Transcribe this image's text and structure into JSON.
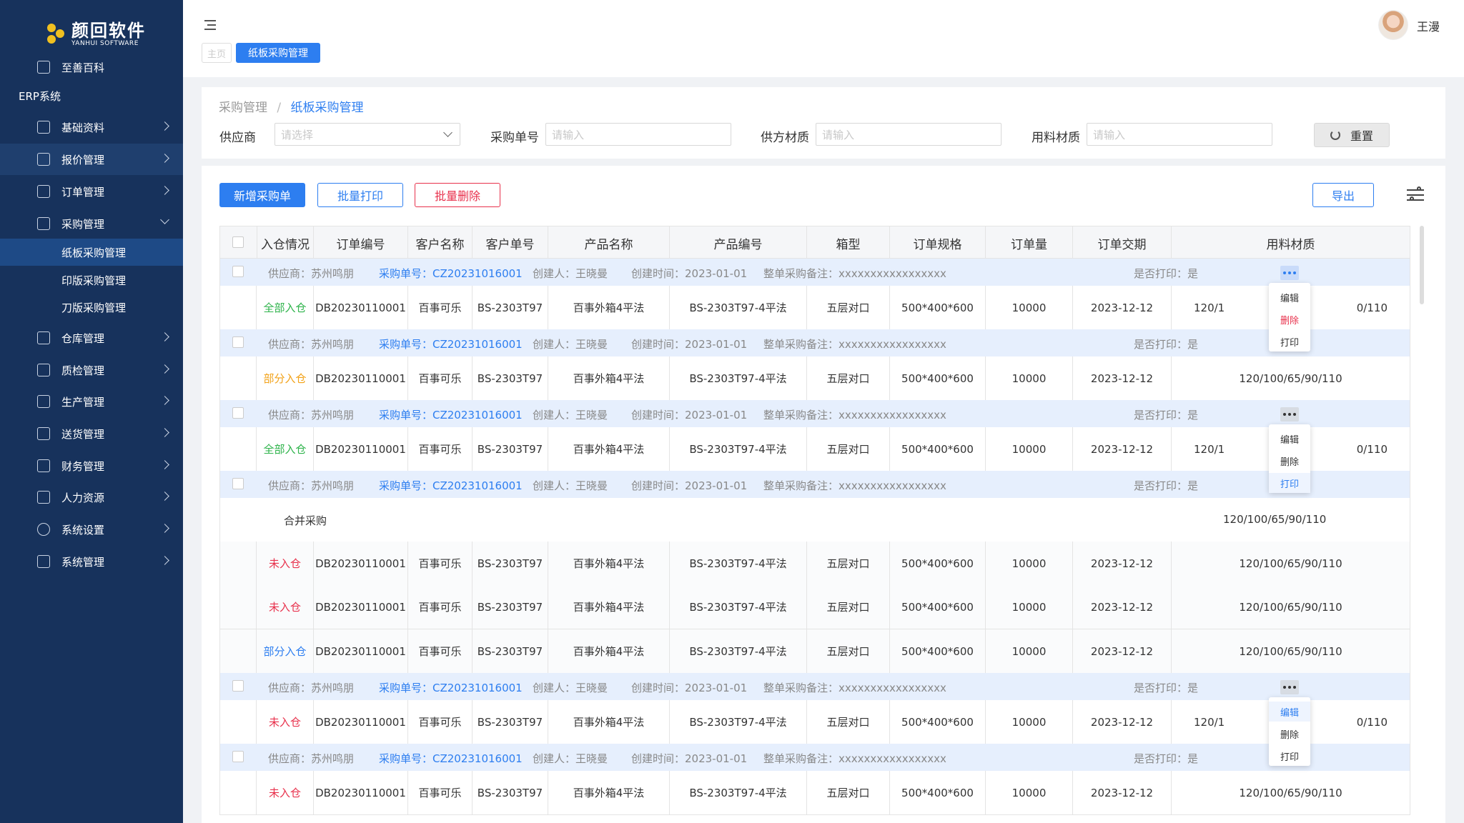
{
  "logo": {
    "cn": "颜回软件",
    "en": "YANHUI SOFTWARE"
  },
  "sidebar": {
    "top_item": {
      "label": "至善百科",
      "icon": "book-icon"
    },
    "section": "ERP系统",
    "items": [
      {
        "label": "基础资料",
        "icon": "profile-icon"
      },
      {
        "label": "报价管理",
        "icon": "quote-icon"
      },
      {
        "label": "订单管理",
        "icon": "order-icon"
      },
      {
        "label": "采购管理",
        "icon": "purchase-icon"
      },
      {
        "label": "仓库管理",
        "icon": "warehouse-icon"
      },
      {
        "label": "质检管理",
        "icon": "shield-icon"
      },
      {
        "label": "生产管理",
        "icon": "calendar-icon"
      },
      {
        "label": "送货管理",
        "icon": "box-icon"
      },
      {
        "label": "财务管理",
        "icon": "finance-icon"
      },
      {
        "label": "人力资源",
        "icon": "person-icon"
      },
      {
        "label": "系统设置",
        "icon": "gear-icon"
      },
      {
        "label": "系统管理",
        "icon": "grid-icon"
      }
    ],
    "sub_items": [
      {
        "label": "纸板采购管理"
      },
      {
        "label": "印版采购管理"
      },
      {
        "label": "刀版采购管理"
      }
    ]
  },
  "header": {
    "tab_home": "主页",
    "tab_active": "纸板采购管理",
    "username": "王漫"
  },
  "breadcrumb": {
    "parent": "采购管理",
    "sep": "/",
    "current": "纸板采购管理"
  },
  "filters": {
    "supplier_label": "供应商",
    "supplier_placeholder": "请选择",
    "order_no_label": "采购单号",
    "order_no_placeholder": "请输入",
    "supplier_material_label": "供方材质",
    "supplier_material_placeholder": "请输入",
    "material_label": "用料材质",
    "material_placeholder": "请输入",
    "reset_label": "重置"
  },
  "toolbar": {
    "add_label": "新增采购单",
    "batch_print_label": "批量打印",
    "batch_delete_label": "批量删除",
    "export_label": "导出"
  },
  "table": {
    "columns": [
      "入仓情况",
      "订单编号",
      "客户名称",
      "客户单号",
      "产品名称",
      "产品编号",
      "箱型",
      "订单规格",
      "订单量",
      "订单交期",
      "用料材质"
    ],
    "group_info": {
      "supplier": "供应商：苏州鸣朋",
      "order_no": "采购单号：CZ20231016001",
      "creator": "创建人：王晓曼",
      "created": "创建时间：2023-01-01",
      "remark": "整单采购备注：xxxxxxxxxxxxxxxxx",
      "printed": "是否打印：是"
    },
    "merge_label": "合并采购",
    "merge_material": "120/100/65/90/110",
    "row": {
      "order_no": "DB20230110001",
      "customer": "百事可乐",
      "customer_no": "BS-2303T97",
      "product": "百事外箱4平法",
      "product_no": "BS-2303T97-4平法",
      "box_type": "五层对口",
      "spec": "500*400*600",
      "qty": "10000",
      "due": "2023-12-12",
      "material": "120/100/65/90/110",
      "material_clipped_left": "120/1",
      "material_clipped_right": "0/110"
    },
    "statuses": [
      "全部入仓",
      "部分入仓",
      "全部入仓",
      "未入仓",
      "未入仓",
      "部分入仓",
      "未入仓",
      "未入仓"
    ],
    "action_menu": {
      "edit": "编辑",
      "delete": "删除",
      "print": "打印"
    }
  },
  "colors": {
    "sidebar": "#17325c",
    "primary": "#2d7ef0",
    "danger": "#e8314c",
    "success": "#2db34a",
    "warning": "#f2a218"
  }
}
